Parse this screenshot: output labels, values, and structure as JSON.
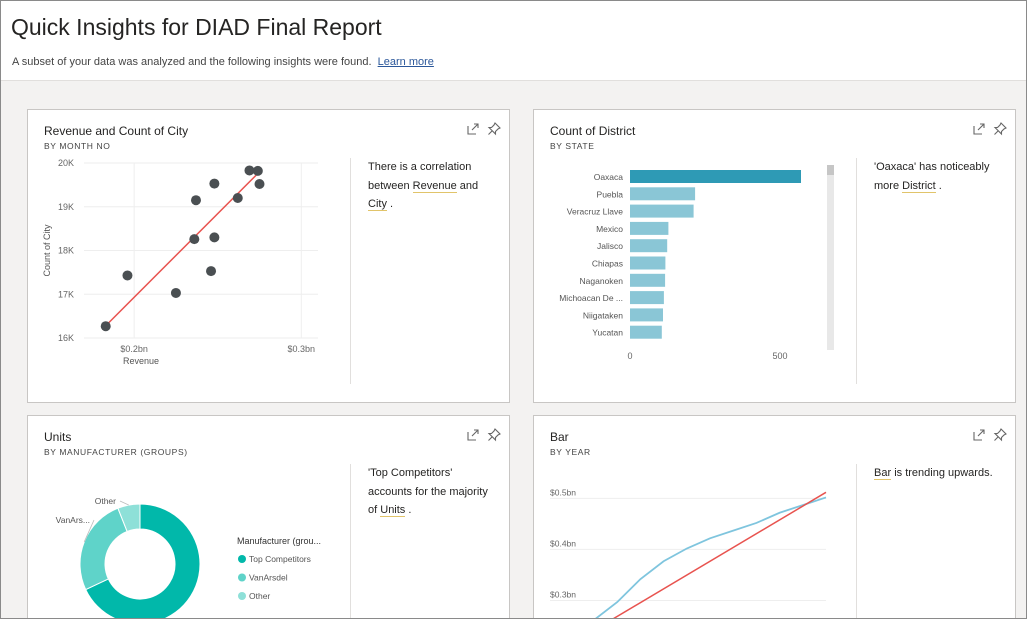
{
  "header": {
    "title": "Quick Insights for DIAD Final Report",
    "subtitle": "A subset of your data was analyzed and the following insights were found.",
    "learn_more": "Learn more"
  },
  "icons": {
    "expand": "expand-icon",
    "pin": "pin-icon"
  },
  "colors": {
    "teal_dark": "#0db3a6",
    "bar_highlight": "#2e9ab5",
    "bar_normal": "#8ac6d6",
    "trend_red": "#e8534f",
    "line_blue": "#7fc5de",
    "dot": "#4a4f52",
    "link": "#2b579a"
  },
  "cards": [
    {
      "title": "Revenue and Count of City",
      "subtitle": "BY MONTH NO",
      "insight": {
        "pre": "There is a correlation between",
        "term1": "Revenue",
        "mid": "and",
        "term2": "City",
        "post": "."
      },
      "chart_data": {
        "type": "scatter",
        "xlabel": "Revenue",
        "ylabel": "Count of City",
        "x_ticks": [
          "$0.2bn",
          "$0.3bn"
        ],
        "y_ticks": [
          "20K",
          "19K",
          "18K",
          "17K",
          "16K"
        ],
        "xlim": [
          0.17,
          0.31
        ],
        "ylim": [
          16000,
          20000
        ],
        "points": [
          {
            "x": 0.183,
            "y": 16270
          },
          {
            "x": 0.196,
            "y": 17430
          },
          {
            "x": 0.225,
            "y": 17030
          },
          {
            "x": 0.236,
            "y": 18260
          },
          {
            "x": 0.237,
            "y": 19150
          },
          {
            "x": 0.246,
            "y": 17530
          },
          {
            "x": 0.248,
            "y": 18300
          },
          {
            "x": 0.248,
            "y": 19530
          },
          {
            "x": 0.262,
            "y": 19200
          },
          {
            "x": 0.269,
            "y": 19830
          },
          {
            "x": 0.274,
            "y": 19820
          },
          {
            "x": 0.275,
            "y": 19520
          }
        ],
        "trendline": [
          [
            0.183,
            16280
          ],
          [
            0.274,
            19760
          ]
        ]
      }
    },
    {
      "title": "Count of District",
      "subtitle": "BY STATE",
      "insight": {
        "pre": "'Oaxaca' has noticeably more",
        "term1": "District",
        "post": "."
      },
      "chart_data": {
        "type": "bar",
        "orientation": "horizontal",
        "categories": [
          "Oaxaca",
          "Puebla",
          "Veracruz Llave",
          "Mexico",
          "Jalisco",
          "Chiapas",
          "Naganoken",
          "Michoacan De ...",
          "Niigataken",
          "Yucatan"
        ],
        "values": [
          570,
          217,
          212,
          128,
          124,
          118,
          117,
          113,
          110,
          106
        ],
        "x_ticks": [
          "0",
          "500"
        ],
        "xlim": [
          0,
          600
        ]
      }
    },
    {
      "title": "Units",
      "subtitle": "BY MANUFACTURER (GROUPS)",
      "insight": {
        "pre": "'Top Competitors' accounts for the majority of",
        "term1": "Units",
        "post": "."
      },
      "chart_data": {
        "type": "pie",
        "donut": true,
        "legend_title": "Manufacturer (grou...",
        "categories": [
          "Top Competitors",
          "VanArsdel",
          "Other"
        ],
        "values": [
          68,
          26,
          6
        ],
        "colors": [
          "#01b8aa",
          "#5fd3c9",
          "#8ee0d8"
        ],
        "slice_labels": [
          "Other",
          "VanArs..."
        ]
      }
    },
    {
      "title": "Bar",
      "subtitle": "BY YEAR",
      "insight": {
        "term1": "Bar",
        "post": "is trending upwards."
      },
      "chart_data": {
        "type": "line",
        "y_ticks": [
          "$0.5bn",
          "$0.4bn",
          "$0.3bn"
        ],
        "ylim": [
          0.25,
          0.5
        ],
        "x": [
          0,
          1,
          2,
          3,
          4,
          5,
          6,
          7,
          8,
          9,
          10
        ],
        "series": [
          {
            "values": [
              0.25,
              0.285,
              0.33,
              0.365,
              0.39,
              0.41,
              0.425,
              0.44,
              0.46,
              0.475,
              0.49
            ]
          }
        ],
        "trendline": [
          [
            0,
            0.23
          ],
          [
            10,
            0.5
          ]
        ]
      }
    }
  ]
}
